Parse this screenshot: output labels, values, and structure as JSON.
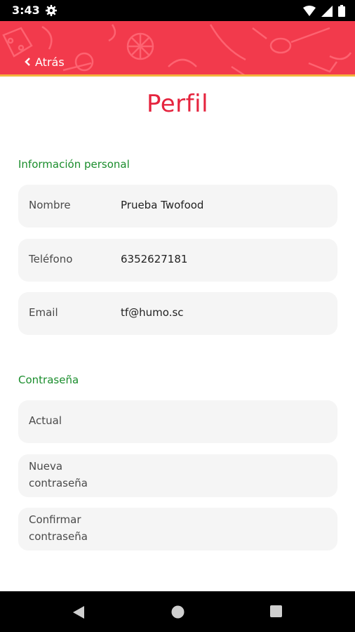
{
  "status_bar": {
    "time": "3:43",
    "icons": [
      "gear-icon",
      "wifi-icon",
      "signal-icon",
      "battery-icon"
    ]
  },
  "header": {
    "back_label": "Atrás",
    "back_icon": "chevron-left-icon",
    "background_color": "#f23a4c",
    "accent_line_color": "#f3b43d"
  },
  "page": {
    "title": "Perfil",
    "title_color": "#e5243e"
  },
  "personal_info": {
    "title": "Información personal",
    "fields": [
      {
        "label": "Nombre",
        "value": "Prueba Twofood"
      },
      {
        "label": "Teléfono",
        "value": "6352627181"
      },
      {
        "label": "Email",
        "value": "tf@humo.sc"
      }
    ]
  },
  "password": {
    "title": "Contraseña",
    "fields": [
      {
        "label": "Actual",
        "value": ""
      },
      {
        "label": "Nueva contraseña",
        "value": ""
      },
      {
        "label": "Confirmar contraseña",
        "value": ""
      }
    ]
  },
  "section_title_color": "#1a8d2c",
  "nav_bar": {
    "buttons": [
      "back-triangle-icon",
      "home-circle-icon",
      "recents-square-icon"
    ]
  }
}
